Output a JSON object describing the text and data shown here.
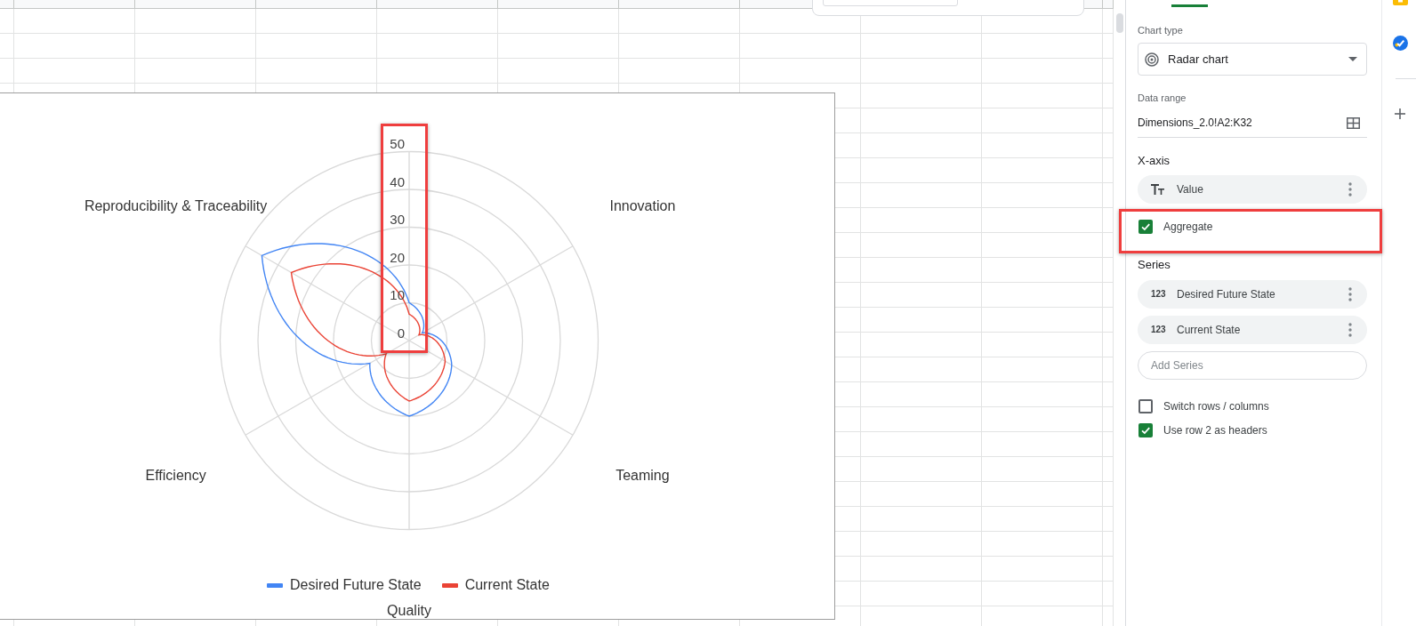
{
  "chart": {
    "axis_ticks": [
      "50",
      "40",
      "30",
      "20",
      "10",
      "0"
    ],
    "axes": [
      "Innovation",
      "Teaming",
      "Quality",
      "Efficiency",
      "Reproducibility & Traceability"
    ],
    "legend": [
      {
        "label": "Desired Future State",
        "color": "#4285f4"
      },
      {
        "label": "Current State",
        "color": "#ea4335"
      }
    ]
  },
  "editor": {
    "tabs": [
      {
        "selected": true
      }
    ],
    "chart_type": {
      "label": "Chart type",
      "value": "Radar chart"
    },
    "data_range": {
      "label": "Data range",
      "value": "Dimensions_2.0!A2:K32"
    },
    "x_axis": {
      "heading": "X-axis",
      "chips": [
        {
          "kind": "text",
          "label": "Value"
        }
      ],
      "aggregate": {
        "label": "Aggregate",
        "checked": true
      }
    },
    "series": {
      "heading": "Series",
      "chips": [
        {
          "kind": "number",
          "glyph": "123",
          "label": "Desired Future State"
        },
        {
          "kind": "number",
          "glyph": "123",
          "label": "Current State"
        }
      ],
      "add_field": {
        "placeholder": "Add Series"
      }
    },
    "options": [
      {
        "label": "Switch rows / columns",
        "checked": false
      },
      {
        "label": "Use row 2 as headers",
        "checked": true
      }
    ]
  }
}
